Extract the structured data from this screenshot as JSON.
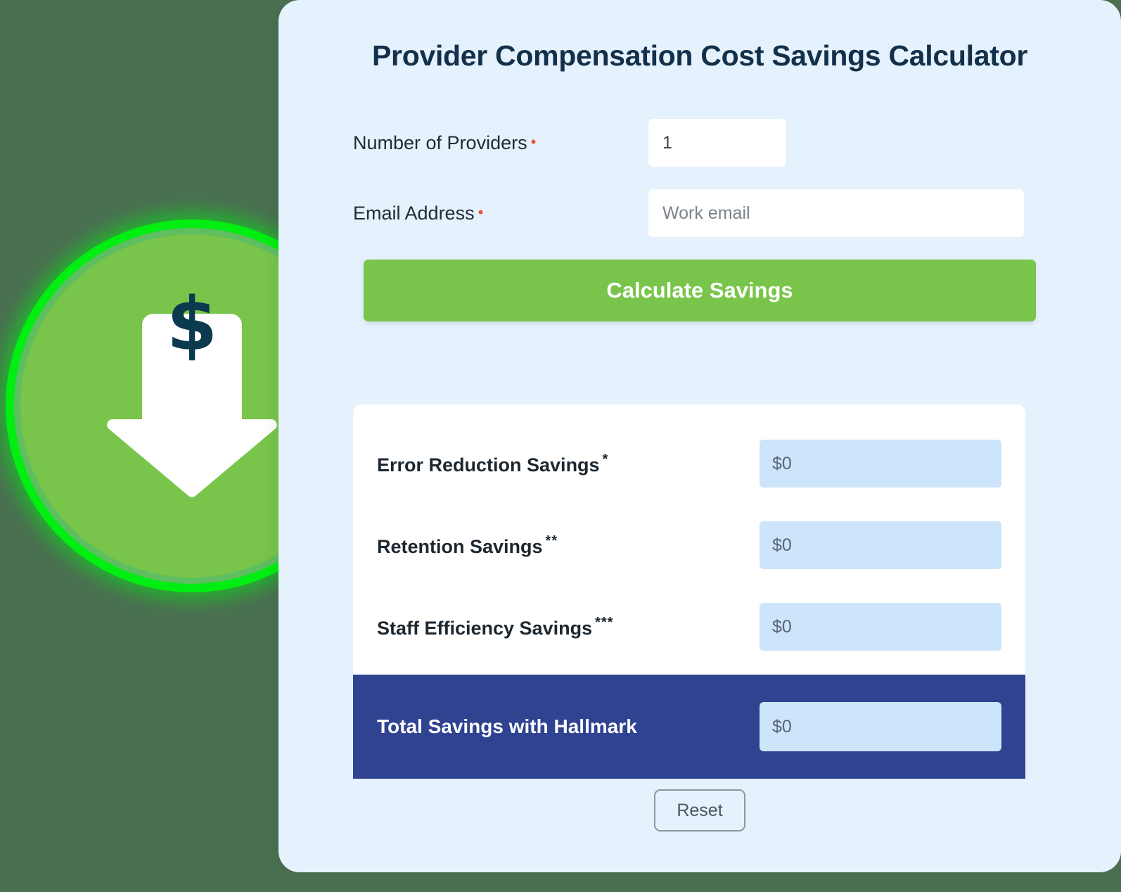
{
  "app": {
    "title": "Provider Compensation Cost Savings Calculator",
    "brand_green": "#79c44a",
    "brand_navy": "#2f4391",
    "card_bg": "#e5f1fc",
    "page_bg": "#4a7051",
    "result_field_bg": "#cce5fb",
    "required_marker_color": "#e8553a"
  },
  "badge": {
    "icon": "dollar-down-arrow-icon",
    "symbol": "$",
    "circle_color": "#79c44a",
    "ring_color": "#00ee11"
  },
  "form": {
    "fields": [
      {
        "label": "Number of Providers",
        "required_marker": "•",
        "value": "1",
        "placeholder": ""
      },
      {
        "label": "Email Address",
        "required_marker": "•",
        "value": "",
        "placeholder": "Work email"
      }
    ],
    "submit_label": "Calculate Savings"
  },
  "results": {
    "rows": [
      {
        "label": "Error Reduction Savings",
        "footnote": "*",
        "value": "$0"
      },
      {
        "label": "Retention Savings",
        "footnote": "**",
        "value": "$0"
      },
      {
        "label": "Staff Efficiency Savings",
        "footnote": "***",
        "value": "$0"
      }
    ],
    "total": {
      "label": "Total Savings with Hallmark",
      "value": "$0"
    }
  },
  "actions": {
    "reset_label": "Reset"
  }
}
